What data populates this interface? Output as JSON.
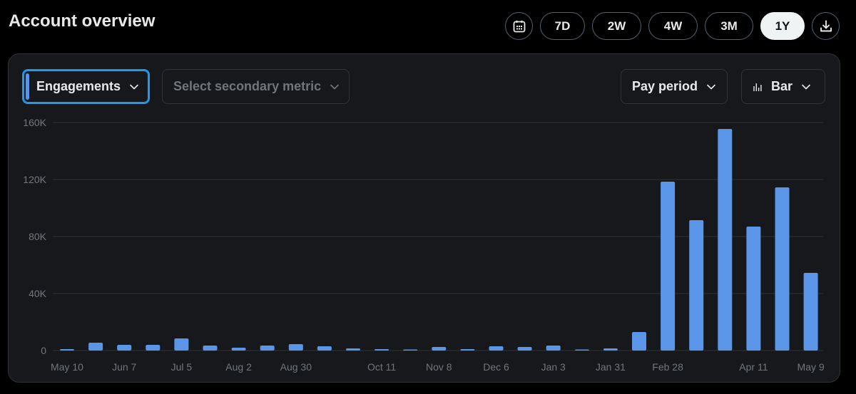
{
  "header": {
    "title": "Account overview"
  },
  "range_buttons": [
    "7D",
    "2W",
    "4W",
    "3M",
    "1Y"
  ],
  "active_range": "1Y",
  "icons": {
    "calendar": "calendar-icon",
    "download": "download-icon",
    "chevron": "chevron-down-icon",
    "bar_chart": "bar-chart-icon"
  },
  "controls": {
    "primary_metric": "Engagements",
    "secondary_metric_placeholder": "Select secondary metric",
    "period": "Pay period",
    "chart_type": "Bar"
  },
  "colors": {
    "bar": "#5b95e8",
    "accent": "#1d9bf0",
    "panel_bg": "#16181c"
  },
  "chart_data": {
    "type": "bar",
    "title": "",
    "xlabel": "",
    "ylabel": "",
    "ylim": [
      0,
      160000
    ],
    "y_ticks": [
      {
        "value": 0,
        "label": "0"
      },
      {
        "value": 40000,
        "label": "40K"
      },
      {
        "value": 80000,
        "label": "80K"
      },
      {
        "value": 120000,
        "label": "120K"
      },
      {
        "value": 160000,
        "label": "160K"
      }
    ],
    "x_labels": [
      "May 10",
      "Jun 7",
      "Jul 5",
      "Aug 2",
      "Aug 30",
      "Oct 11",
      "Nov 8",
      "Dec 6",
      "Jan 3",
      "Jan 31",
      "Feb 28",
      "Apr 11",
      "May 9"
    ],
    "x_label_bar_index": [
      0,
      2,
      4,
      6,
      8,
      11,
      13,
      15,
      17,
      19,
      21,
      24,
      26
    ],
    "grid": true,
    "values": [
      1000,
      5500,
      4000,
      4000,
      8500,
      3500,
      2000,
      3500,
      4500,
      3000,
      1500,
      1000,
      500,
      2500,
      1000,
      3000,
      2500,
      3500,
      500,
      1500,
      13000,
      118500,
      91500,
      155500,
      87000,
      114500,
      54500
    ]
  }
}
